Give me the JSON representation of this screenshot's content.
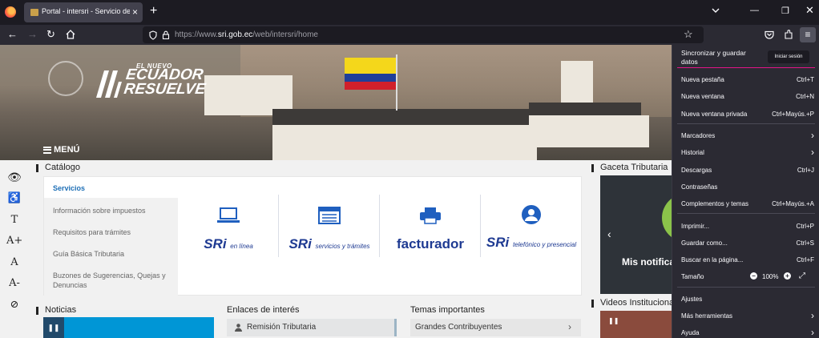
{
  "browser": {
    "tab_title": "Portal - intersri - Servicio de Rentas Internas",
    "new_tab": "+",
    "tab_close": "×",
    "url_prefix": "https://www.",
    "url_host": "sri.gob.ec",
    "url_path": "/web/intersri/home"
  },
  "hero": {
    "slogan_small": "EL NUEVO",
    "slogan_line1": "ECUADOR",
    "slogan_line2": "RESUELVE",
    "menu_label": "MENÚ"
  },
  "accessibility_tools": [
    "👁",
    "♿",
    "T",
    "A+",
    "A",
    "A-",
    "⊘"
  ],
  "sections": {
    "catalogo": "Catálogo",
    "gaceta": "Gaceta Tributaria",
    "noticias": "Noticias",
    "enlaces": "Enlaces de interés",
    "temas": "Temas importantes",
    "videos": "Videos Institucionales"
  },
  "catalog": {
    "active": "Servicios",
    "items": [
      "Información sobre impuestos",
      "Requisitos para trámites",
      "Guía Básica Tributaria",
      "Buzones de Sugerencias, Quejas y Denuncias"
    ],
    "services": [
      {
        "main": "SRi",
        "sub": "en línea"
      },
      {
        "main": "SRi",
        "sub": "servicios y trámites"
      },
      {
        "main": "facturador",
        "sub": ""
      },
      {
        "main": "SRi",
        "sub": "telefónico y presencial"
      }
    ]
  },
  "gaceta_text": "Mis notificaciones",
  "enlace_item": "Remisión Tributaria",
  "tema_item": "Grandes Contribuyentes",
  "app_menu": {
    "sync_title": "Sincronizar y guardar datos",
    "sync_button": "Iniciar sesión",
    "items": [
      {
        "label": "Nueva pestaña",
        "key": "Ctrl+T"
      },
      {
        "label": "Nueva ventana",
        "key": "Ctrl+N"
      },
      {
        "label": "Nueva ventana privada",
        "key": "Ctrl+Mayús.+P"
      },
      {
        "label": "Marcadores",
        "key": "›"
      },
      {
        "label": "Historial",
        "key": "›"
      },
      {
        "label": "Descargas",
        "key": "Ctrl+J"
      },
      {
        "label": "Contraseñas",
        "key": ""
      },
      {
        "label": "Complementos y temas",
        "key": "Ctrl+Mayús.+A"
      },
      {
        "label": "Imprimir...",
        "key": "Ctrl+P"
      },
      {
        "label": "Guardar como...",
        "key": "Ctrl+S"
      },
      {
        "label": "Buscar en la página...",
        "key": "Ctrl+F"
      },
      {
        "label": "Ajustes",
        "key": ""
      },
      {
        "label": "Más herramientas",
        "key": "›"
      },
      {
        "label": "Ayuda",
        "key": "›"
      }
    ],
    "zoom_label": "Tamaño",
    "zoom_value": "100%"
  }
}
